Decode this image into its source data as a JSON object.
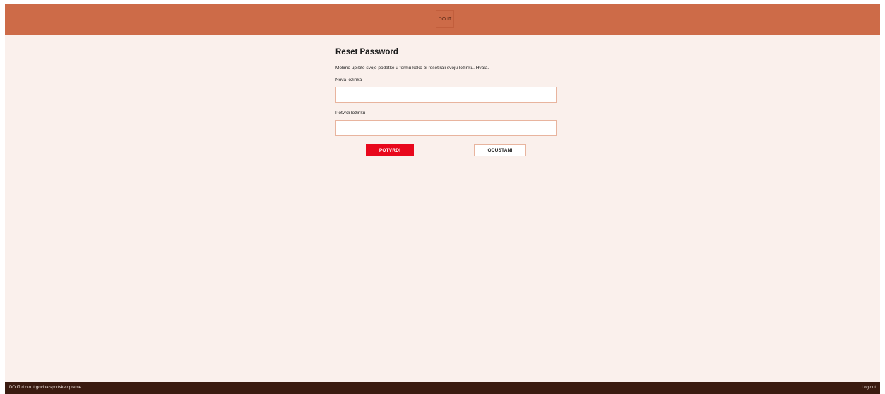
{
  "header": {
    "logo_text": "DO IT",
    "background_color": "#cd6b48"
  },
  "form": {
    "title": "Reset Password",
    "description": "Molimo upišite svoje podatke u formu kako bi resetirali svoju lozinku. Hvala.",
    "new_password_label": "Nova lozinka",
    "new_password_value": "",
    "confirm_password_label": "Potvrdi lozinku",
    "confirm_password_value": "",
    "confirm_button_label": "POTVRDI",
    "cancel_button_label": "ODUSTANI"
  },
  "footer": {
    "company_text": "DO IT d.o.o. trgovina sportske opreme",
    "logout_label": "Log out",
    "background_color": "#3a1b10"
  },
  "colors": {
    "page_background": "#faf0ec",
    "accent_button": "#e8081c",
    "input_border": "#e8b49e"
  }
}
